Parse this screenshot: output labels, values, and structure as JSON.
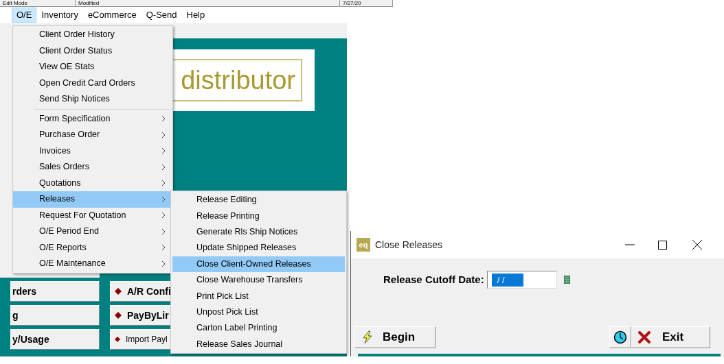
{
  "status_strip": [
    "Edit Mode",
    "Modified",
    "7/27/20"
  ],
  "menu_bar": [
    {
      "label": "O/E",
      "selected": true
    },
    {
      "label": "Inventory",
      "selected": false
    },
    {
      "label": "eCommerce",
      "selected": false
    },
    {
      "label": "Q-Send",
      "selected": false
    },
    {
      "label": "Help",
      "selected": false
    }
  ],
  "logo": {
    "text": "distributor"
  },
  "background_buttons": [
    [
      {
        "label": "rders",
        "kind": "plain"
      },
      {
        "label": "A/R Confi",
        "kind": "diamond"
      }
    ],
    [
      {
        "label": "g",
        "kind": "plain"
      },
      {
        "label": "PayByLir",
        "kind": "diamond"
      }
    ],
    [
      {
        "label": "y/Usage",
        "kind": "plain"
      },
      {
        "label": "Import Payl",
        "kind": "diamond_small"
      }
    ]
  ],
  "oe_menu": {
    "groups": [
      [
        {
          "label": "Client Order History",
          "submenu": false,
          "selected": false
        },
        {
          "label": "Client Order Status",
          "submenu": false,
          "selected": false
        },
        {
          "label": "View OE Stats",
          "submenu": false,
          "selected": false
        },
        {
          "label": "Open Credit Card Orders",
          "submenu": false,
          "selected": false
        },
        {
          "label": "Send Ship Notices",
          "submenu": false,
          "selected": false
        }
      ],
      [
        {
          "label": "Form Specification",
          "submenu": true,
          "selected": false
        },
        {
          "label": "Purchase Order",
          "submenu": true,
          "selected": false
        },
        {
          "label": "Invoices",
          "submenu": true,
          "selected": false
        },
        {
          "label": "Sales Orders",
          "submenu": true,
          "selected": false
        },
        {
          "label": "Quotations",
          "submenu": true,
          "selected": false
        },
        {
          "label": "Releases",
          "submenu": true,
          "selected": true
        },
        {
          "label": "Request For Quotation",
          "submenu": true,
          "selected": false
        },
        {
          "label": "O/E Period End",
          "submenu": true,
          "selected": false
        },
        {
          "label": "O/E Reports",
          "submenu": true,
          "selected": false
        },
        {
          "label": "O/E Maintenance",
          "submenu": true,
          "selected": false
        }
      ]
    ]
  },
  "releases_submenu": {
    "items": [
      {
        "label": "Release Editing",
        "selected": false
      },
      {
        "label": "Release Printing",
        "selected": false
      },
      {
        "label": "Generate Rls Ship Notices",
        "selected": false
      },
      {
        "label": "Update Shipped Releases",
        "selected": false
      },
      {
        "label": "Close Client-Owned Releases",
        "selected": true
      },
      {
        "label": "Close Warehouse Transfers",
        "selected": false
      },
      {
        "label": "Print Pick List",
        "selected": false
      },
      {
        "label": "Unpost Pick List",
        "selected": false
      },
      {
        "label": "Carton Label Printing",
        "selected": false
      },
      {
        "label": "Release Sales Journal",
        "selected": false
      }
    ]
  },
  "dialog": {
    "icon_text": "eq",
    "title": "Close Releases",
    "field": {
      "label": "Release Cutoff Date:",
      "value": "/ /",
      "selected": true
    },
    "buttons": [
      {
        "kind": "begin",
        "label": "Begin"
      },
      {
        "kind": "clock"
      },
      {
        "kind": "exit",
        "label": "Exit"
      }
    ]
  }
}
